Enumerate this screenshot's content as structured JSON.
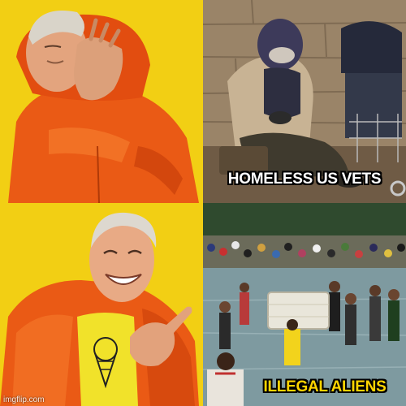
{
  "meme": {
    "top_caption": "HOMELESS US VETS",
    "bottom_caption": "ILLEGAL ALIENS",
    "watermark": "imgflip.com"
  },
  "colors": {
    "background_yellow": "#f5d21a",
    "jacket_orange": "#f0641c",
    "caption_white": "#ffffff",
    "caption_yellow": "#ffd400"
  }
}
